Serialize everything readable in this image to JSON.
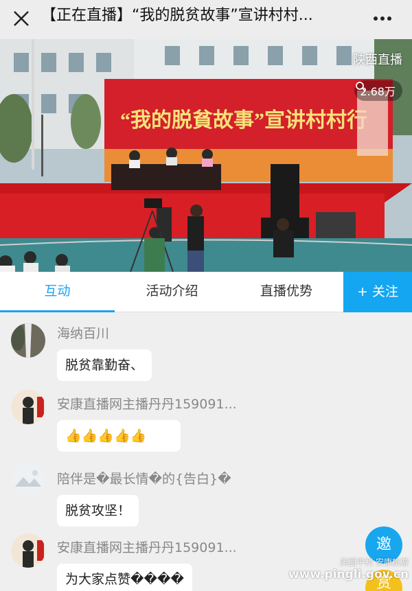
{
  "header": {
    "title": "【正在直播】“我的脱贫故事”宣讲村村...",
    "close_icon": "close-icon",
    "more_icon": "more-icon"
  },
  "video": {
    "channel": "陕西直播",
    "viewers": "2.68万",
    "banner_text": "“我的脱貧故事”宣讲村村行"
  },
  "tabs": [
    {
      "label": "互动",
      "active": true
    },
    {
      "label": "活动介绍",
      "active": false
    },
    {
      "label": "直播优势",
      "active": false
    }
  ],
  "follow_label": "+ 关注",
  "messages": [
    {
      "user": "海纳百川",
      "text": "脱贫靠勤奋、"
    },
    {
      "user": "安康直播网主播丹丹159091...",
      "text": "👍👍👍👍👍"
    },
    {
      "user": "陪伴是�最长情�的{告白}�",
      "text": "脱贫攻坚！"
    },
    {
      "user": "安康直播网主播丹丹159091...",
      "text": "为大家点赞����"
    }
  ],
  "invite_label": "邀",
  "reward_label": "赏",
  "watermark": {
    "line1": "美丽平利 安康旅游",
    "site": "www.pingli.gov.cn"
  },
  "colors": {
    "accent": "#15a6f1",
    "reward": "#f4c01c"
  }
}
